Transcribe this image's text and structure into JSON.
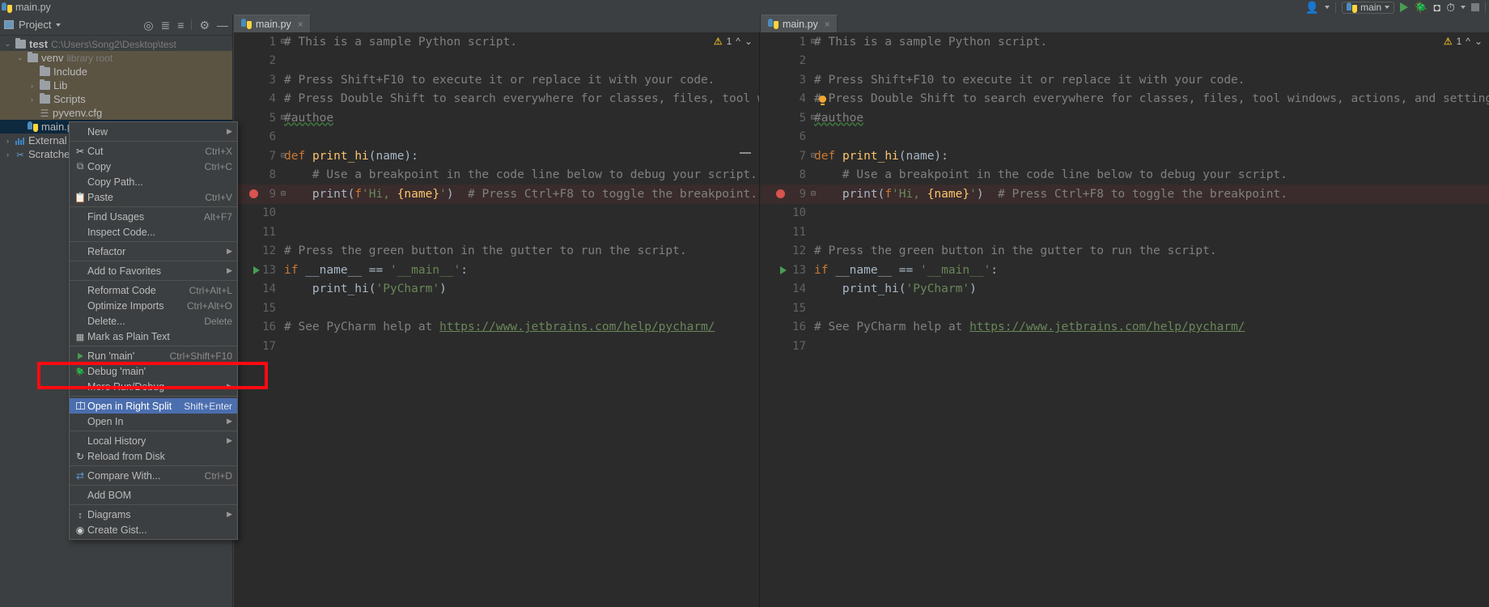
{
  "window": {
    "breadcrumb_file": "main.py",
    "icons": {
      "python_file": "python-file-icon"
    }
  },
  "toolbar": {
    "user_icon": "user-icon",
    "run_config": "main",
    "run_label": "run-button",
    "debug_label": "debug-button",
    "coverage_label": "run-with-coverage-button",
    "profile_label": "profile-button",
    "stop_label": "stop-button"
  },
  "project_panel": {
    "title": "Project",
    "actions": [
      "locate-icon",
      "expand-all-icon",
      "collapse-all-icon",
      "settings-icon",
      "hide-icon"
    ],
    "tree": [
      {
        "label": "test",
        "detail": "C:\\Users\\Song2\\Desktop\\test",
        "arrow": "⌄",
        "indent": 0,
        "kind": "folder",
        "state": "normal"
      },
      {
        "label": "venv",
        "detail": "library root",
        "arrow": "⌄",
        "indent": 1,
        "kind": "folder",
        "state": "brown"
      },
      {
        "label": "Include",
        "detail": "",
        "arrow": "",
        "indent": 2,
        "kind": "folder",
        "state": "brown"
      },
      {
        "label": "Lib",
        "detail": "",
        "arrow": "›",
        "indent": 2,
        "kind": "folder",
        "state": "brown"
      },
      {
        "label": "Scripts",
        "detail": "",
        "arrow": "›",
        "indent": 2,
        "kind": "folder",
        "state": "brown"
      },
      {
        "label": "pyvenv.cfg",
        "detail": "",
        "arrow": "",
        "indent": 2,
        "kind": "cfg",
        "state": "brown"
      },
      {
        "label": "main.py",
        "detail": "",
        "arrow": "",
        "indent": 1,
        "kind": "python",
        "state": "blue"
      },
      {
        "label": "External Libraries",
        "detail": "",
        "arrow": "›",
        "indent": 0,
        "kind": "lib",
        "state": "normal"
      },
      {
        "label": "Scratches and Consoles",
        "detail": "",
        "arrow": "›",
        "indent": 0,
        "kind": "scratch",
        "state": "normal"
      }
    ]
  },
  "context_menu": {
    "items": [
      {
        "icon": "",
        "label": "New",
        "key": "",
        "submenu": true,
        "highlight": false
      },
      {
        "sep": true
      },
      {
        "icon": "cut-icon",
        "label": "Cut",
        "key": "Ctrl+X",
        "submenu": false,
        "highlight": false
      },
      {
        "icon": "copy-icon",
        "label": "Copy",
        "key": "Ctrl+C",
        "submenu": false,
        "highlight": false
      },
      {
        "icon": "",
        "label": "Copy Path...",
        "key": "",
        "submenu": false,
        "highlight": false
      },
      {
        "icon": "paste-icon",
        "label": "Paste",
        "key": "Ctrl+V",
        "submenu": false,
        "highlight": false
      },
      {
        "sep": true
      },
      {
        "icon": "",
        "label": "Find Usages",
        "key": "Alt+F7",
        "submenu": false,
        "highlight": false
      },
      {
        "icon": "",
        "label": "Inspect Code...",
        "key": "",
        "submenu": false,
        "highlight": false
      },
      {
        "sep": true
      },
      {
        "icon": "",
        "label": "Refactor",
        "key": "",
        "submenu": true,
        "highlight": false
      },
      {
        "sep": true
      },
      {
        "icon": "",
        "label": "Add to Favorites",
        "key": "",
        "submenu": true,
        "highlight": false
      },
      {
        "sep": true
      },
      {
        "icon": "",
        "label": "Reformat Code",
        "key": "Ctrl+Alt+L",
        "submenu": false,
        "highlight": false
      },
      {
        "icon": "",
        "label": "Optimize Imports",
        "key": "Ctrl+Alt+O",
        "submenu": false,
        "highlight": false
      },
      {
        "icon": "",
        "label": "Delete...",
        "key": "Delete",
        "submenu": false,
        "highlight": false
      },
      {
        "icon": "plain-text-icon",
        "label": "Mark as Plain Text",
        "key": "",
        "submenu": false,
        "highlight": false
      },
      {
        "sep": true
      },
      {
        "icon": "run-icon",
        "label": "Run 'main'",
        "key": "Ctrl+Shift+F10",
        "submenu": false,
        "highlight": false
      },
      {
        "icon": "debug-icon",
        "label": "Debug 'main'",
        "key": "",
        "submenu": false,
        "highlight": false
      },
      {
        "icon": "",
        "label": "More Run/Debug",
        "key": "",
        "submenu": true,
        "highlight": false
      },
      {
        "sep": true
      },
      {
        "icon": "split-icon",
        "label": "Open in Right Split",
        "key": "Shift+Enter",
        "submenu": false,
        "highlight": true
      },
      {
        "icon": "",
        "label": "Open In",
        "key": "",
        "submenu": true,
        "highlight": false
      },
      {
        "sep": true
      },
      {
        "icon": "",
        "label": "Local History",
        "key": "",
        "submenu": true,
        "highlight": false
      },
      {
        "icon": "reload-icon",
        "label": "Reload from Disk",
        "key": "",
        "submenu": false,
        "highlight": false
      },
      {
        "sep": true
      },
      {
        "icon": "compare-icon",
        "label": "Compare With...",
        "key": "Ctrl+D",
        "submenu": false,
        "highlight": false
      },
      {
        "sep": true
      },
      {
        "icon": "",
        "label": "Add BOM",
        "key": "",
        "submenu": false,
        "highlight": false
      },
      {
        "sep": true
      },
      {
        "icon": "diagram-icon",
        "label": "Diagrams",
        "key": "",
        "submenu": true,
        "highlight": false
      },
      {
        "icon": "github-icon",
        "label": "Create Gist...",
        "key": "",
        "submenu": false,
        "highlight": false
      }
    ],
    "highlight_color": "#4b6eaf",
    "annotation_color": "#ff0a12"
  },
  "editor": {
    "tab_label": "main.py",
    "close_icon": "close-icon",
    "inspection": {
      "count": "1",
      "warn_icon": "warning-triangle-icon",
      "up_icon": "chevron-up-icon",
      "down_icon": "chevron-down-icon"
    },
    "lines": [
      {
        "n": "1",
        "text": "# This is a sample Python script.",
        "cls": "c-com",
        "fold": true
      },
      {
        "n": "2",
        "text": "",
        "cls": "c-com",
        "fold": false
      },
      {
        "n": "3",
        "text": "# Press Shift+F10 to execute it or replace it with your code.",
        "cls": "c-com",
        "fold": false,
        "indent": 0
      },
      {
        "n": "4",
        "text": "# Press Double Shift to search everywhere for classes, files, tool windows, actions, and settings.",
        "cls": "c-com",
        "fold": false,
        "indent": 0
      },
      {
        "n": "5",
        "text": "#authoe",
        "cls": "c-com squig",
        "fold": true
      },
      {
        "n": "6",
        "text": "",
        "cls": "c-com",
        "fold": false
      },
      {
        "n": "7",
        "html": true,
        "fold": true
      },
      {
        "n": "8",
        "text": "    # Use a breakpoint in the code line below to debug your script.",
        "cls": "c-com",
        "fold": false
      },
      {
        "n": "9",
        "html": true,
        "breakpoint": true,
        "fold": true,
        "hl": true
      },
      {
        "n": "10",
        "text": "",
        "cls": "c-com",
        "fold": false
      },
      {
        "n": "11",
        "text": "",
        "cls": "c-com",
        "fold": false
      },
      {
        "n": "12",
        "text": "# Press the green button in the gutter to run the script.",
        "cls": "c-com",
        "fold": false
      },
      {
        "n": "13",
        "html": true,
        "runmark": true,
        "fold": false
      },
      {
        "n": "14",
        "html": true,
        "fold": false
      },
      {
        "n": "15",
        "text": "",
        "cls": "c-com",
        "fold": false
      },
      {
        "n": "16",
        "html": true,
        "fold": false
      },
      {
        "n": "17",
        "text": "",
        "cls": "c-com",
        "fold": false
      }
    ],
    "code_html": {
      "l7": "<span class=\"c-kw\">def</span> <span class=\"c-fn\">print_hi</span><span class=\"c-txt\">(name):</span>",
      "l9": "<span class=\"c-txt\">    print(</span><span class=\"c-kw\">f</span><span class=\"c-str\">'Hi, </span><span class=\"c-fn\">{name}</span><span class=\"c-str\">'</span><span class=\"c-txt\">)</span>  <span class=\"c-com\"># Press Ctrl+F8 to toggle the breakpoint.</span>",
      "l13": "<span class=\"c-kw\">if</span> <span class=\"c-txt\">__name__ == </span><span class=\"c-str\">'__main__'</span><span class=\"c-txt\">:</span>",
      "l14": "<span class=\"c-txt\">    print_hi(</span><span class=\"c-str\">'PyCharm'</span><span class=\"c-txt\">)</span>",
      "l16": "<span class=\"c-com\"># See PyCharm help at </span><span class=\"c-link\">https://www.jetbrains.com/help/pycharm/</span>"
    },
    "colors": {
      "background": "#2b2b2b",
      "gutter_text": "#606366",
      "comment": "#808080",
      "keyword": "#cc7832",
      "string": "#6a8759",
      "function": "#ffc66d",
      "breakpoint": "#d9534f",
      "run_marker": "#499c54",
      "highlight_line": "#3a2c2c"
    }
  }
}
